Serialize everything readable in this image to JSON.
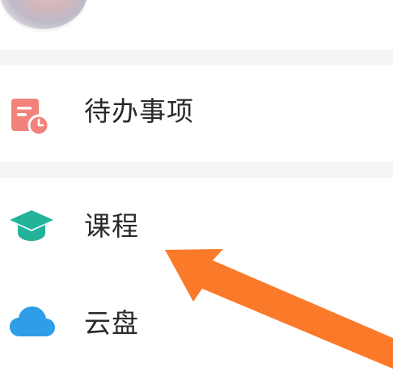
{
  "menu": {
    "items": [
      {
        "label": "待办事项",
        "icon": "todo-calendar-icon",
        "color": "#f2837a"
      },
      {
        "label": "课程",
        "icon": "graduation-cap-icon",
        "color": "#23b29a"
      },
      {
        "label": "云盘",
        "icon": "cloud-icon",
        "color": "#2f9de8"
      }
    ]
  },
  "colors": {
    "divider": "#f4f4f6",
    "arrow": "#fb7a2a"
  }
}
